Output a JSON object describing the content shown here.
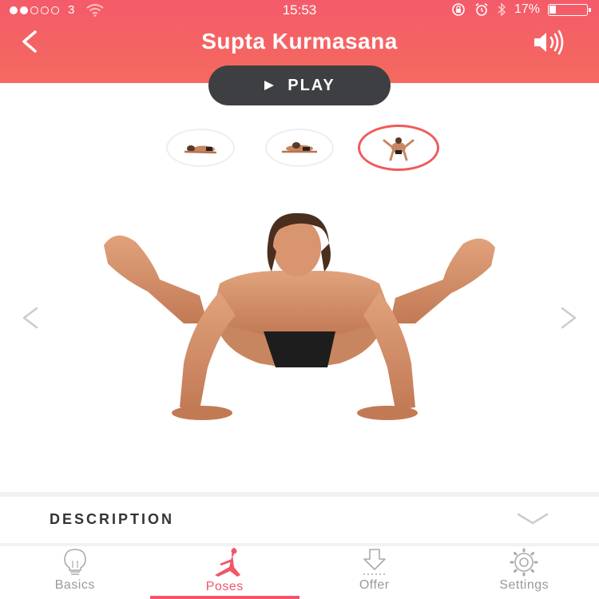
{
  "status_bar": {
    "carrier": "3",
    "signal_filled": 2,
    "signal_total": 5,
    "time": "15:53",
    "battery_percent": "17%",
    "battery_level": 0.17
  },
  "header": {
    "title": "Supta Kurmasana",
    "back_icon": "chevron-left-icon",
    "sound_icon": "speaker-icon",
    "gradient_top": "#f45b6a",
    "gradient_bottom": "#f46a5e"
  },
  "player": {
    "play_label": "PLAY",
    "play_icon": "play-triangle-icon",
    "button_color": "#3e3f43"
  },
  "pose_thumbnails": [
    {
      "name": "pose-step-1",
      "active": false
    },
    {
      "name": "pose-step-2",
      "active": false
    },
    {
      "name": "pose-step-3",
      "active": true
    }
  ],
  "navigation": {
    "prev_icon": "chevron-left-icon",
    "next_icon": "chevron-right-icon"
  },
  "description": {
    "label": "DESCRIPTION",
    "chevron_icon": "chevron-down-icon"
  },
  "tabs": [
    {
      "label": "Basics",
      "icon": "lightbulb-icon",
      "active": false
    },
    {
      "label": "Poses",
      "icon": "yoga-pose-icon",
      "active": true
    },
    {
      "label": "Offer",
      "icon": "download-arrow-icon",
      "active": false
    },
    {
      "label": "Settings",
      "icon": "gear-icon",
      "active": false
    }
  ],
  "colors": {
    "accent": "#f05668",
    "inactive_tab": "#999999",
    "active_thumb_border": "#f05a5a"
  }
}
